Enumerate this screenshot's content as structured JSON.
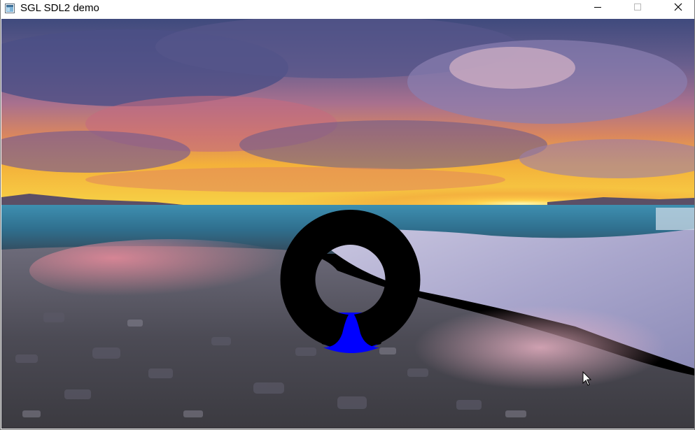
{
  "window": {
    "title": "SGL SDL2 demo",
    "app_icon": "sdl-window-icon",
    "controls": {
      "minimize_icon": "minimize-icon",
      "maximize_icon": "maximize-icon",
      "close_icon": "close-icon"
    }
  },
  "canvas": {
    "background": "sunset-beach-photo",
    "ring": {
      "fill_color": "#000000",
      "inner_fill_color": "#0000ff"
    }
  },
  "cursor": {
    "icon": "arrow-pointer-icon"
  },
  "colors": {
    "titlebar_bg": "#ffffff",
    "ring_black": "#000000",
    "ring_blue": "#0000ff"
  }
}
